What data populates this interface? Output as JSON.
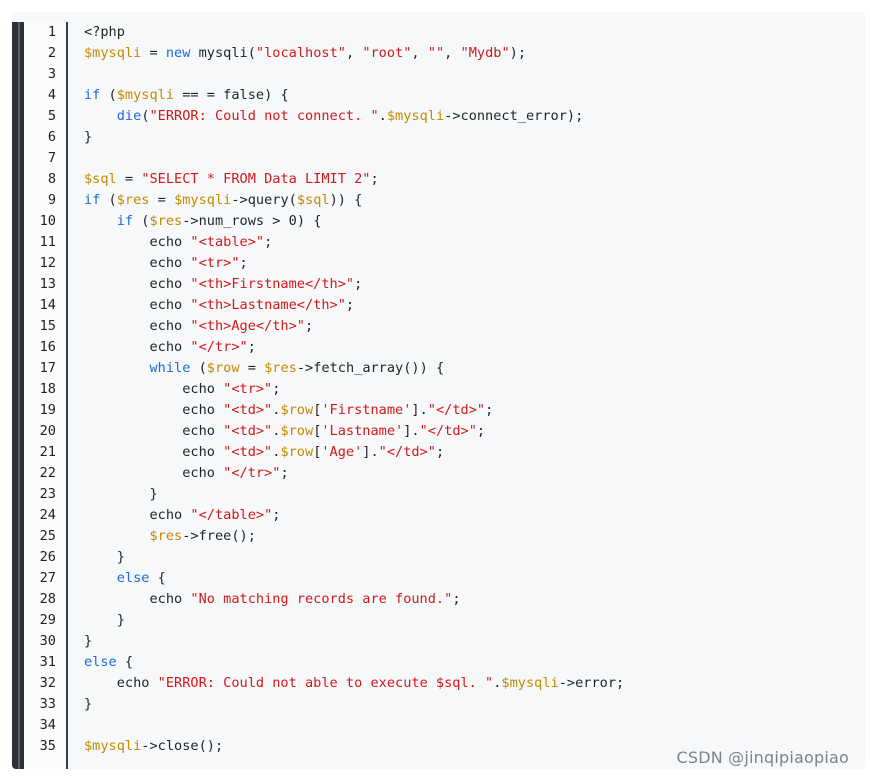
{
  "watermark": "CSDN @jinqipiaopiao",
  "line_numbers": [
    "1",
    "2",
    "3",
    "4",
    "5",
    "6",
    "7",
    "8",
    "9",
    "10",
    "11",
    "12",
    "13",
    "14",
    "15",
    "16",
    "17",
    "18",
    "19",
    "20",
    "21",
    "22",
    "23",
    "24",
    "25",
    "26",
    "27",
    "28",
    "29",
    "30",
    "31",
    "32",
    "33",
    "34",
    "35"
  ],
  "colors": {
    "variable": "#c48a00",
    "keyword": "#1d6ad6",
    "string": "#d41818",
    "text": "#1f2328"
  },
  "lines": [
    [
      [
        "t",
        "<?php"
      ]
    ],
    [
      [
        "v",
        "$mysqli"
      ],
      [
        "t",
        " = "
      ],
      [
        "k",
        "new"
      ],
      [
        "t",
        " mysqli("
      ],
      [
        "s",
        "\"localhost\""
      ],
      [
        "t",
        ", "
      ],
      [
        "s",
        "\"root\""
      ],
      [
        "t",
        ", "
      ],
      [
        "s",
        "\"\""
      ],
      [
        "t",
        ", "
      ],
      [
        "s",
        "\"Mydb\""
      ],
      [
        "t",
        ");"
      ]
    ],
    [],
    [
      [
        "k",
        "if"
      ],
      [
        "t",
        " ("
      ],
      [
        "v",
        "$mysqli"
      ],
      [
        "t",
        " == = false) {"
      ]
    ],
    [
      [
        "t",
        "    "
      ],
      [
        "k",
        "die"
      ],
      [
        "t",
        "("
      ],
      [
        "s",
        "\"ERROR: Could not connect. \""
      ],
      [
        "t",
        "."
      ],
      [
        "v",
        "$mysqli"
      ],
      [
        "t",
        "->connect_error);"
      ]
    ],
    [
      [
        "t",
        "}"
      ]
    ],
    [],
    [
      [
        "v",
        "$sql"
      ],
      [
        "t",
        " = "
      ],
      [
        "s",
        "\"SELECT * FROM Data LIMIT 2\""
      ],
      [
        "t",
        ";"
      ]
    ],
    [
      [
        "k",
        "if"
      ],
      [
        "t",
        " ("
      ],
      [
        "v",
        "$res"
      ],
      [
        "t",
        " = "
      ],
      [
        "v",
        "$mysqli"
      ],
      [
        "t",
        "->query("
      ],
      [
        "v",
        "$sql"
      ],
      [
        "t",
        ")) {"
      ]
    ],
    [
      [
        "t",
        "    "
      ],
      [
        "k",
        "if"
      ],
      [
        "t",
        " ("
      ],
      [
        "v",
        "$res"
      ],
      [
        "t",
        "->num_rows > 0) {"
      ]
    ],
    [
      [
        "t",
        "        echo "
      ],
      [
        "s",
        "\"<table>\""
      ],
      [
        "t",
        ";"
      ]
    ],
    [
      [
        "t",
        "        echo "
      ],
      [
        "s",
        "\"<tr>\""
      ],
      [
        "t",
        ";"
      ]
    ],
    [
      [
        "t",
        "        echo "
      ],
      [
        "s",
        "\"<th>Firstname</th>\""
      ],
      [
        "t",
        ";"
      ]
    ],
    [
      [
        "t",
        "        echo "
      ],
      [
        "s",
        "\"<th>Lastname</th>\""
      ],
      [
        "t",
        ";"
      ]
    ],
    [
      [
        "t",
        "        echo "
      ],
      [
        "s",
        "\"<th>Age</th>\""
      ],
      [
        "t",
        ";"
      ]
    ],
    [
      [
        "t",
        "        echo "
      ],
      [
        "s",
        "\"</tr>\""
      ],
      [
        "t",
        ";"
      ]
    ],
    [
      [
        "t",
        "        "
      ],
      [
        "k",
        "while"
      ],
      [
        "t",
        " ("
      ],
      [
        "v",
        "$row"
      ],
      [
        "t",
        " = "
      ],
      [
        "v",
        "$res"
      ],
      [
        "t",
        "->fetch_array()) {"
      ]
    ],
    [
      [
        "t",
        "            echo "
      ],
      [
        "s",
        "\"<tr>\""
      ],
      [
        "t",
        ";"
      ]
    ],
    [
      [
        "t",
        "            echo "
      ],
      [
        "s",
        "\"<td>\""
      ],
      [
        "t",
        "."
      ],
      [
        "v",
        "$row"
      ],
      [
        "t",
        "["
      ],
      [
        "s",
        "'Firstname'"
      ],
      [
        "t",
        "]."
      ],
      [
        "s",
        "\"</td>\""
      ],
      [
        "t",
        ";"
      ]
    ],
    [
      [
        "t",
        "            echo "
      ],
      [
        "s",
        "\"<td>\""
      ],
      [
        "t",
        "."
      ],
      [
        "v",
        "$row"
      ],
      [
        "t",
        "["
      ],
      [
        "s",
        "'Lastname'"
      ],
      [
        "t",
        "]."
      ],
      [
        "s",
        "\"</td>\""
      ],
      [
        "t",
        ";"
      ]
    ],
    [
      [
        "t",
        "            echo "
      ],
      [
        "s",
        "\"<td>\""
      ],
      [
        "t",
        "."
      ],
      [
        "v",
        "$row"
      ],
      [
        "t",
        "["
      ],
      [
        "s",
        "'Age'"
      ],
      [
        "t",
        "]."
      ],
      [
        "s",
        "\"</td>\""
      ],
      [
        "t",
        ";"
      ]
    ],
    [
      [
        "t",
        "            echo "
      ],
      [
        "s",
        "\"</tr>\""
      ],
      [
        "t",
        ";"
      ]
    ],
    [
      [
        "t",
        "        }"
      ]
    ],
    [
      [
        "t",
        "        echo "
      ],
      [
        "s",
        "\"</table>\""
      ],
      [
        "t",
        ";"
      ]
    ],
    [
      [
        "t",
        "        "
      ],
      [
        "v",
        "$res"
      ],
      [
        "t",
        "->free();"
      ]
    ],
    [
      [
        "t",
        "    }"
      ]
    ],
    [
      [
        "t",
        "    "
      ],
      [
        "k",
        "else"
      ],
      [
        "t",
        " {"
      ]
    ],
    [
      [
        "t",
        "        echo "
      ],
      [
        "s",
        "\"No matching records are found.\""
      ],
      [
        "t",
        ";"
      ]
    ],
    [
      [
        "t",
        "    }"
      ]
    ],
    [
      [
        "t",
        "}"
      ]
    ],
    [
      [
        "k",
        "else"
      ],
      [
        "t",
        " {"
      ]
    ],
    [
      [
        "t",
        "    echo "
      ],
      [
        "s",
        "\"ERROR: Could not able to execute $sql. \""
      ],
      [
        "t",
        "."
      ],
      [
        "v",
        "$mysqli"
      ],
      [
        "t",
        "->error;"
      ]
    ],
    [
      [
        "t",
        "}"
      ]
    ],
    [],
    [
      [
        "v",
        "$mysqli"
      ],
      [
        "t",
        "->close();"
      ]
    ]
  ]
}
